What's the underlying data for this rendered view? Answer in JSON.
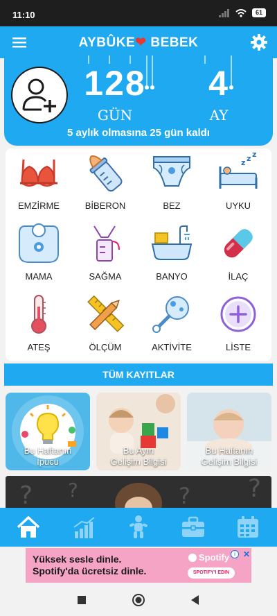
{
  "status_bar": {
    "time": "11:10",
    "battery": "61"
  },
  "app_bar": {
    "title_left": "AYBÛKE",
    "title_heart": "❤",
    "title_right": "BEBEK"
  },
  "age": {
    "days": "128",
    "days_unit": "GÜN",
    "months": "4",
    "months_unit": "AY",
    "remaining_text": "5 aylık olmasına 25 gün kaldı"
  },
  "grid": {
    "items": [
      {
        "label": "EMZİRME",
        "icon": "bra-icon"
      },
      {
        "label": "BİBERON",
        "icon": "baby-bottle-icon"
      },
      {
        "label": "BEZ",
        "icon": "diaper-icon"
      },
      {
        "label": "UYKU",
        "icon": "sleep-bed-icon"
      },
      {
        "label": "MAMA",
        "icon": "bib-icon"
      },
      {
        "label": "SAĞMA",
        "icon": "breast-pump-icon"
      },
      {
        "label": "BANYO",
        "icon": "bathtub-icon"
      },
      {
        "label": "İLAÇ",
        "icon": "pill-icon"
      },
      {
        "label": "ATEŞ",
        "icon": "thermometer-icon"
      },
      {
        "label": "ÖLÇÜM",
        "icon": "ruler-pencil-icon"
      },
      {
        "label": "AKTİVİTE",
        "icon": "rattle-icon"
      },
      {
        "label": "LİSTE",
        "icon": "plus-circle-icon"
      }
    ]
  },
  "all_records": "TÜM KAYITLAR",
  "cards": [
    {
      "label_1": "Bu Haftanın",
      "label_2": "İpucu"
    },
    {
      "label_1": "Bu Ayın",
      "label_2": "Gelişim Bilgisi"
    },
    {
      "label_1": "Bu Haftanın",
      "label_2": "Gelişim Bilgisi"
    }
  ],
  "bottom_nav": [
    "home-icon",
    "chart-icon",
    "baby-icon",
    "briefcase-icon",
    "calendar-icon"
  ],
  "ad": {
    "line1": "Yüksek sesle dinle.",
    "line2": "Spotify'da ücretsiz dinle.",
    "brand": "Spotify",
    "cta": "SPOTIFY'I EDIN"
  },
  "colors": {
    "primary": "#1fa9f1",
    "heart": "#e53935"
  }
}
